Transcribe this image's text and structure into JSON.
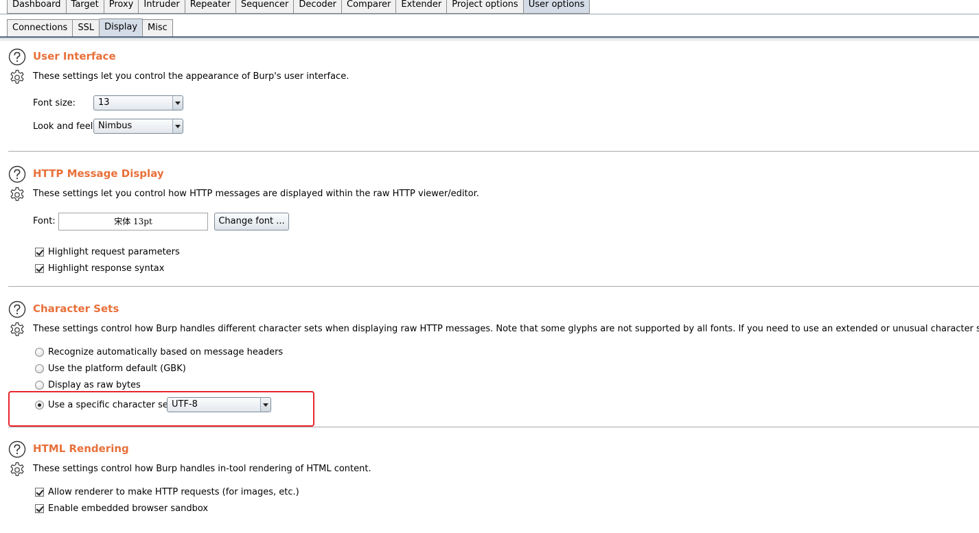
{
  "main_tabs": [
    {
      "label": "Dashboard",
      "active": false
    },
    {
      "label": "Target",
      "active": false
    },
    {
      "label": "Proxy",
      "active": false
    },
    {
      "label": "Intruder",
      "active": false
    },
    {
      "label": "Repeater",
      "active": false
    },
    {
      "label": "Sequencer",
      "active": false
    },
    {
      "label": "Decoder",
      "active": false
    },
    {
      "label": "Comparer",
      "active": false
    },
    {
      "label": "Extender",
      "active": false
    },
    {
      "label": "Project options",
      "active": false
    },
    {
      "label": "User options",
      "active": true
    }
  ],
  "sub_tabs": [
    {
      "label": "Connections",
      "active": false
    },
    {
      "label": "SSL",
      "active": false
    },
    {
      "label": "Display",
      "active": true
    },
    {
      "label": "Misc",
      "active": false
    }
  ],
  "user_interface": {
    "title": "User Interface",
    "description": "These settings let you control the appearance of Burp's user interface.",
    "font_size_label": "Font size:",
    "font_size_value": "13",
    "look_feel_label": "Look and feel:",
    "look_feel_value": "Nimbus"
  },
  "http_display": {
    "title": "HTTP Message Display",
    "description": "These settings let you control how HTTP messages are displayed within the raw HTTP viewer/editor.",
    "font_label": "Font:",
    "font_value": "宋体 13pt",
    "change_font_button": "Change font ...",
    "highlight_params": {
      "label": "Highlight request parameters",
      "checked": true
    },
    "highlight_syntax": {
      "label": "Highlight response syntax",
      "checked": true
    }
  },
  "character_sets": {
    "title": "Character Sets",
    "description": "These settings control how Burp handles different character sets when displaying raw HTTP messages. Note that some glyphs are not supported by all fonts. If you need to use an extended or unusual character set, you should first try a sys",
    "options": [
      {
        "label": "Recognize automatically based on message headers",
        "checked": false
      },
      {
        "label": "Use the platform default (GBK)",
        "checked": false
      },
      {
        "label": "Display as raw bytes",
        "checked": false
      },
      {
        "label": "Use a specific character set:",
        "checked": true
      }
    ],
    "charset_value": "UTF-8",
    "highlight_color": "#e8262b"
  },
  "html_rendering": {
    "title": "HTML Rendering",
    "description": "These settings control how Burp handles in-tool rendering of HTML content.",
    "allow_requests": {
      "label": "Allow renderer to make HTTP requests (for images, etc.)",
      "checked": true
    },
    "sandbox": {
      "label": "Enable embedded browser sandbox",
      "checked": true
    }
  },
  "colors": {
    "title_orange": "#e8703a",
    "active_tab": "#d4dde7"
  }
}
